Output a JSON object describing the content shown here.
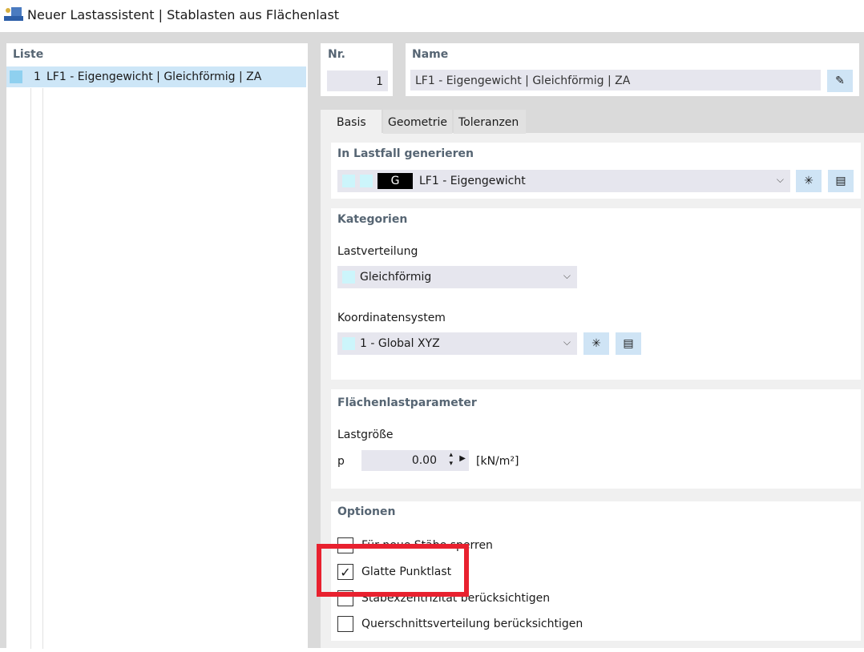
{
  "window": {
    "title": "Neuer Lastassistent | Stablasten aus Flächenlast"
  },
  "list": {
    "header": "Liste",
    "items": [
      {
        "number": "1",
        "label": "LF1 - Eigengewicht | Gleichförmig | ZA"
      }
    ]
  },
  "nr": {
    "label": "Nr.",
    "value": "1"
  },
  "name": {
    "label": "Name",
    "value": "LF1 - Eigengewicht | Gleichförmig | ZA"
  },
  "tabs": [
    {
      "label": "Basis",
      "active": true
    },
    {
      "label": "Geometrie"
    },
    {
      "label": "Toleranzen"
    }
  ],
  "load_case": {
    "header": "In Lastfall generieren",
    "badge": "G",
    "value": "LF1 - Eigengewicht"
  },
  "categories": {
    "header": "Kategorien",
    "distribution_label": "Lastverteilung",
    "distribution_value": "Gleichförmig",
    "coord_label": "Koordinatensystem",
    "coord_value": "1 - Global XYZ"
  },
  "area_load": {
    "header": "Flächenlastparameter",
    "size_label": "Lastgröße",
    "symbol": "p",
    "value": "0.00",
    "unit": "[kN/m²]"
  },
  "options": {
    "header": "Optionen",
    "items": [
      {
        "label": "Für neue Stäbe sperren",
        "checked": false
      },
      {
        "label": "Glatte Punktlast",
        "checked": true
      },
      {
        "label": "Stabexzentrizität berücksichtigen",
        "checked": false
      },
      {
        "label": "Querschnittsverteilung berücksichtigen",
        "checked": false
      }
    ]
  },
  "colors": {
    "highlight": "#e8212f",
    "selection": "#cde6f7"
  }
}
